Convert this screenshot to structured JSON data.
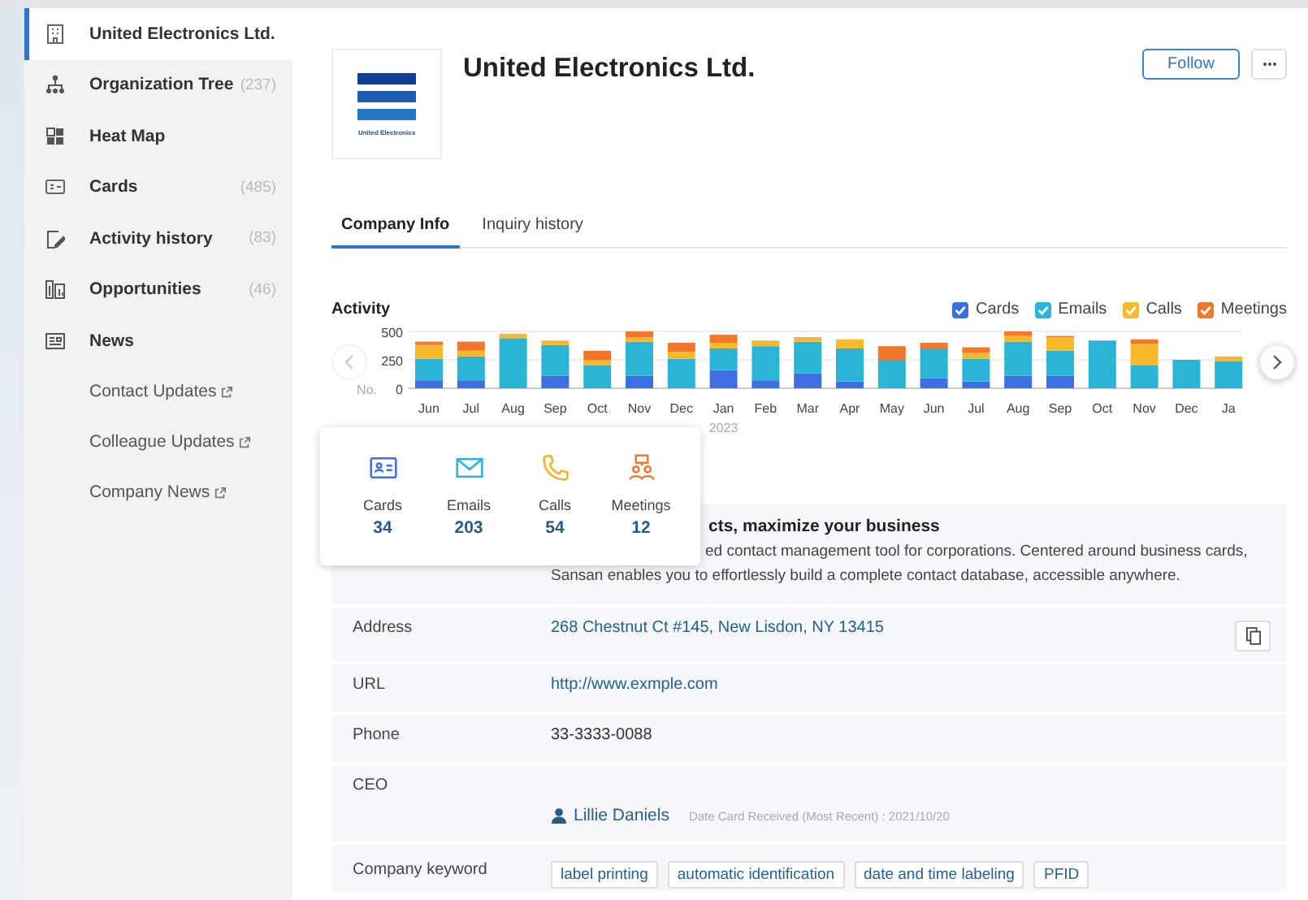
{
  "sidebar": {
    "items": [
      {
        "kind": "building",
        "label": "United Electronics Ltd.",
        "selected": true
      },
      {
        "kind": "tree",
        "label": "Organization Tree",
        "count": "(237)",
        "selected": false
      },
      {
        "kind": "heatmap",
        "label": "Heat Map",
        "selected": false
      },
      {
        "kind": "card",
        "label": "Cards",
        "count": "(485)",
        "selected": false
      },
      {
        "kind": "activity",
        "label": "Activity history",
        "count": "(83)",
        "selected": false
      },
      {
        "kind": "opportunity",
        "label": "Opportunities",
        "count": "(46)",
        "selected": false
      },
      {
        "kind": "news",
        "label": "News",
        "selected": false,
        "children": [
          {
            "label": "Contact Updates",
            "external": true
          },
          {
            "label": "Colleague Updates",
            "external": true
          },
          {
            "label": "Company News",
            "external": true
          }
        ]
      }
    ]
  },
  "company": {
    "name": "United Electronics Ltd.",
    "logo_text": "United Electronics",
    "follow": "Follow"
  },
  "tabs": [
    {
      "label": "Company Info",
      "selected": true
    },
    {
      "label": "Inquiry history",
      "selected": false
    }
  ],
  "activity": {
    "title": "Activity",
    "legend": [
      {
        "checked": true
      },
      {
        "checked": true
      },
      {
        "checked": true
      },
      {
        "checked": true
      }
    ],
    "chart_data": {
      "type": "bar",
      "stacked": true,
      "ylabel": "No.",
      "ylim": [
        0,
        500
      ],
      "yticks": [
        0,
        250,
        500
      ],
      "categories": [
        "Jun",
        "Jul",
        "Aug",
        "Sep",
        "Oct",
        "Nov",
        "Dec",
        "Jan",
        "Feb",
        "Mar",
        "Apr",
        "May",
        "Jun",
        "Jul",
        "Aug",
        "Sep",
        "Oct",
        "Nov",
        "Dec",
        "Ja"
      ],
      "series": [
        {
          "name": "Cards",
          "color": "#3d6fe0",
          "values": [
            70,
            70,
            0,
            110,
            0,
            110,
            0,
            160,
            70,
            130,
            60,
            0,
            90,
            60,
            110,
            110,
            0,
            0,
            0,
            0
          ]
        },
        {
          "name": "Emails",
          "color": "#2ab5d6",
          "values": [
            190,
            210,
            440,
            270,
            200,
            300,
            260,
            190,
            300,
            280,
            290,
            250,
            260,
            200,
            300,
            220,
            420,
            200,
            250,
            240
          ]
        },
        {
          "name": "Calls",
          "color": "#f6b92b",
          "values": [
            120,
            50,
            40,
            40,
            50,
            40,
            60,
            50,
            50,
            40,
            80,
            0,
            0,
            50,
            50,
            120,
            0,
            190,
            0,
            40
          ]
        },
        {
          "name": "Meetings",
          "color": "#f0772b",
          "values": [
            30,
            80,
            0,
            0,
            80,
            50,
            80,
            70,
            0,
            0,
            0,
            120,
            50,
            50,
            40,
            10,
            0,
            40,
            0,
            0
          ]
        }
      ],
      "annotations": [
        "2023"
      ]
    }
  },
  "popover": {
    "items": [
      {
        "kind": "cards",
        "label": "Cards",
        "value": "34"
      },
      {
        "kind": "emails",
        "label": "Emails",
        "value": "203"
      },
      {
        "kind": "calls",
        "label": "Calls",
        "value": "54"
      },
      {
        "kind": "meetings",
        "label": "Meetings",
        "value": "12"
      }
    ]
  },
  "description": {
    "title": "cts, maximize your business",
    "lines": [
      "ed contact management tool for corporations. Centered around business cards,",
      "Sansan enables you to effortlessly build a complete contact database, accessible anywhere."
    ]
  },
  "fields": [
    {
      "kind": "address",
      "label": "Address",
      "value": "268 Chestnut Ct #145, New Lisdon, NY 13415"
    },
    {
      "kind": "link",
      "label": "URL",
      "value": "http://www.exmple.com"
    },
    {
      "kind": "text",
      "label": "Phone",
      "value": "33-3333-0088"
    },
    {
      "kind": "person",
      "label": "CEO",
      "value": "Lillie Daniels",
      "note": "Date Card Received (Most Recent) : 2021/10/20"
    },
    {
      "kind": "tags",
      "label": "Company keyword",
      "tags": [
        "label printing",
        "automatic identification",
        "date and time labeling",
        "PFID"
      ]
    }
  ]
}
